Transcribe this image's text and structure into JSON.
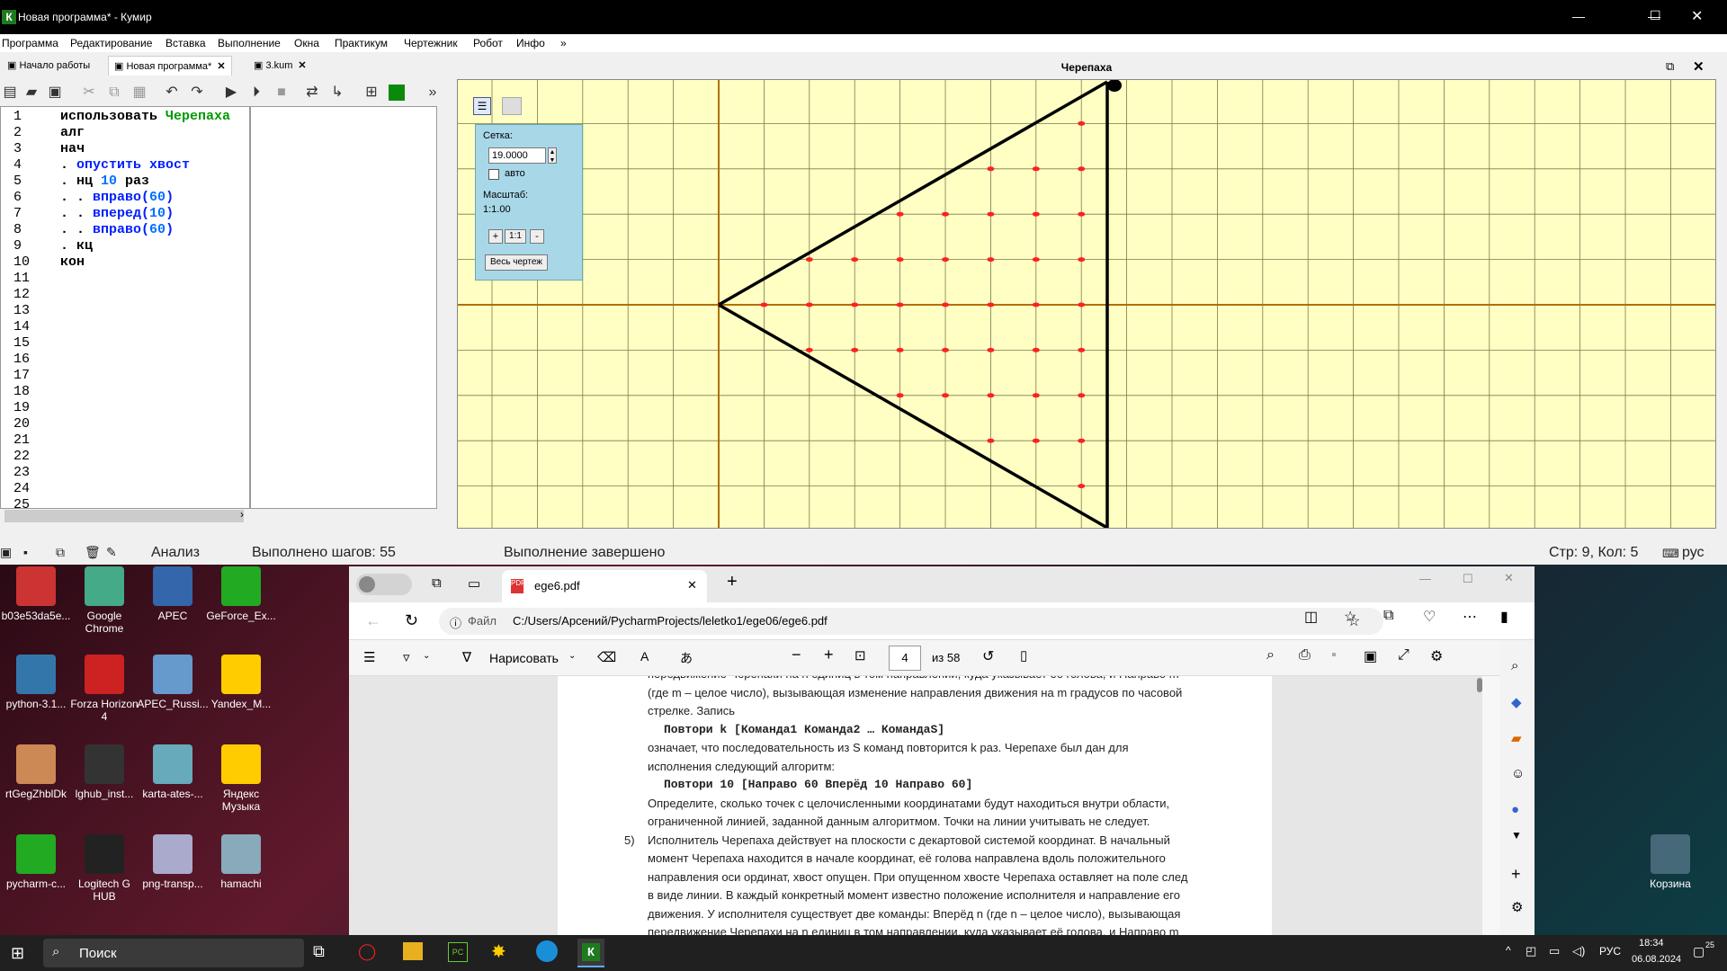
{
  "window": {
    "title": "Новая программа* - Кумир",
    "icon_letter": "К"
  },
  "menu": [
    "Программа",
    "Редактирование",
    "Вставка",
    "Выполнение",
    "Окна",
    "Практикум",
    "Чертежник",
    "Робот",
    "Инфо",
    "»"
  ],
  "tabs": [
    {
      "label": "Начало работы"
    },
    {
      "label": "Новая программа*",
      "close": "✕"
    },
    {
      "label": "3.kum",
      "close": "✕"
    }
  ],
  "editor": {
    "line_numbers": [
      "1",
      "2",
      "3",
      "4",
      "5",
      "6",
      "7",
      "8",
      "9",
      "10",
      "11",
      "12",
      "13",
      "14",
      "15",
      "16",
      "17",
      "18",
      "19",
      "20",
      "21",
      "22",
      "23",
      "24",
      "25"
    ],
    "lines": [
      [
        {
          "t": "использовать ",
          "c": "kw"
        },
        {
          "t": "Черепаха",
          "c": "gr"
        }
      ],
      [
        {
          "t": "алг",
          "c": "kw"
        }
      ],
      [
        {
          "t": "нач",
          "c": "kw"
        }
      ],
      [
        {
          "t": ". ",
          "c": "kw"
        },
        {
          "t": "опустить хвост",
          "c": "bl"
        }
      ],
      [
        {
          "t": ". нц ",
          "c": "kw"
        },
        {
          "t": "10",
          "c": "num"
        },
        {
          "t": " раз",
          "c": "kw"
        }
      ],
      [
        {
          "t": ". . ",
          "c": "kw"
        },
        {
          "t": "вправо",
          "c": "bl"
        },
        {
          "t": "(",
          "c": "bl"
        },
        {
          "t": "60",
          "c": "num"
        },
        {
          "t": ")",
          "c": "bl"
        }
      ],
      [
        {
          "t": ". . ",
          "c": "kw"
        },
        {
          "t": "вперед",
          "c": "bl"
        },
        {
          "t": "(",
          "c": "bl"
        },
        {
          "t": "10",
          "c": "num"
        },
        {
          "t": ")",
          "c": "bl"
        }
      ],
      [
        {
          "t": ". . ",
          "c": "kw"
        },
        {
          "t": "вправо",
          "c": "bl"
        },
        {
          "t": "(",
          "c": "bl"
        },
        {
          "t": "60",
          "c": "num"
        },
        {
          "t": ")",
          "c": "bl"
        }
      ],
      [
        {
          "t": ". кц",
          "c": "kw"
        }
      ],
      [
        {
          "t": "кон",
          "c": "kw"
        }
      ]
    ]
  },
  "turtle": {
    "title": "Черепаха",
    "grid_label": "Сетка:",
    "grid_value": "19.0000",
    "auto_label": "авто",
    "scale_label": "Масштаб:",
    "scale_value": "1:1.00",
    "zoom_in": "+",
    "zoom_reset": "1:1",
    "zoom_out": "-",
    "fit_button": "Весь чертеж",
    "colors": {
      "background": "#ffffc4",
      "grid": "#7a7a4a",
      "axis": "#b07000",
      "line": "#000000",
      "points": "#ff2020"
    }
  },
  "status": {
    "analysis": "Анализ",
    "steps": "Выполнено шагов: 55",
    "done": "Выполнение завершено",
    "cursor": "Стр: 9, Кол: 5",
    "lang": "рус"
  },
  "desktop_icons": [
    {
      "label": "b03e53da5e..."
    },
    {
      "label": "Google Chrome"
    },
    {
      "label": "APEC"
    },
    {
      "label": "GeForce_Ex..."
    },
    {
      "label": "python-3.1..."
    },
    {
      "label": "Forza Horizon 4"
    },
    {
      "label": "APEC_Russi..."
    },
    {
      "label": "Yandex_M..."
    },
    {
      "label": "rtGegZhblDk"
    },
    {
      "label": "lghub_inst..."
    },
    {
      "label": "karta-ates-..."
    },
    {
      "label": "Яндекс Музыка"
    },
    {
      "label": "pycharm-c..."
    },
    {
      "label": "Logitech G HUB"
    },
    {
      "label": "png-transp..."
    },
    {
      "label": "hamachi"
    }
  ],
  "recycle_bin": "Корзина",
  "browser": {
    "tab_title": "ege6.pdf",
    "addr_prefix": "Файл",
    "url": "C:/Users/Арсений/PycharmProjects/leletko1/ege06/ege6.pdf",
    "draw_label": "Нарисовать",
    "page_num": "4",
    "page_total": "из 58"
  },
  "pdf": {
    "lines": [
      {
        "t": "передвижение Черепахи на n единиц в том направлении, куда указывает её голова, и Направо m",
        "c": "n"
      },
      {
        "t": "(где m – целое число), вызывающая изменение направления движения на m градусов по часовой",
        "c": "n"
      },
      {
        "t": "стрелке. Запись",
        "c": "n"
      },
      {
        "t": "Повтори k [Команда1 Команда2 … КомандаS]",
        "c": "m"
      },
      {
        "t": "означает, что последовательность из S команд повторится k раз. Черепахе был дан для",
        "c": "n"
      },
      {
        "t": "исполнения следующий алгоритм:",
        "c": "n"
      },
      {
        "t": "Повтори 10 [Направо 60 Вперёд 10 Направо 60]",
        "c": "m"
      },
      {
        "t": "Определите, сколько точек с целочисленными координатами будут находиться внутри области,",
        "c": "n"
      },
      {
        "t": "ограниченной линией, заданной данным алгоритмом. Точки на линии учитывать не следует.",
        "c": "n"
      },
      {
        "t": "Исполнитель Черепаха действует на плоскости с декартовой системой координат. В начальный",
        "c": "n",
        "num": "5)"
      },
      {
        "t": "момент Черепаха находится в начале координат, её голова направлена вдоль положительного",
        "c": "n"
      },
      {
        "t": "направления оси ординат, хвост опущен. При опущенном хвосте Черепаха оставляет на поле след",
        "c": "n"
      },
      {
        "t": "в виде линии. В каждый конкретный момент известно положение исполнителя и направление его",
        "c": "n"
      },
      {
        "t": "движения. У исполнителя существует две команды: Вперёд n (где n – целое число), вызывающая",
        "c": "n"
      },
      {
        "t": "передвижение Черепахи на n единиц в том направлении, куда указывает её голова, и Направо m",
        "c": "n"
      }
    ]
  },
  "taskbar": {
    "search": "Поиск",
    "lang": "РУС",
    "time": "18:34",
    "date": "06.08.2024",
    "notif": "25"
  }
}
